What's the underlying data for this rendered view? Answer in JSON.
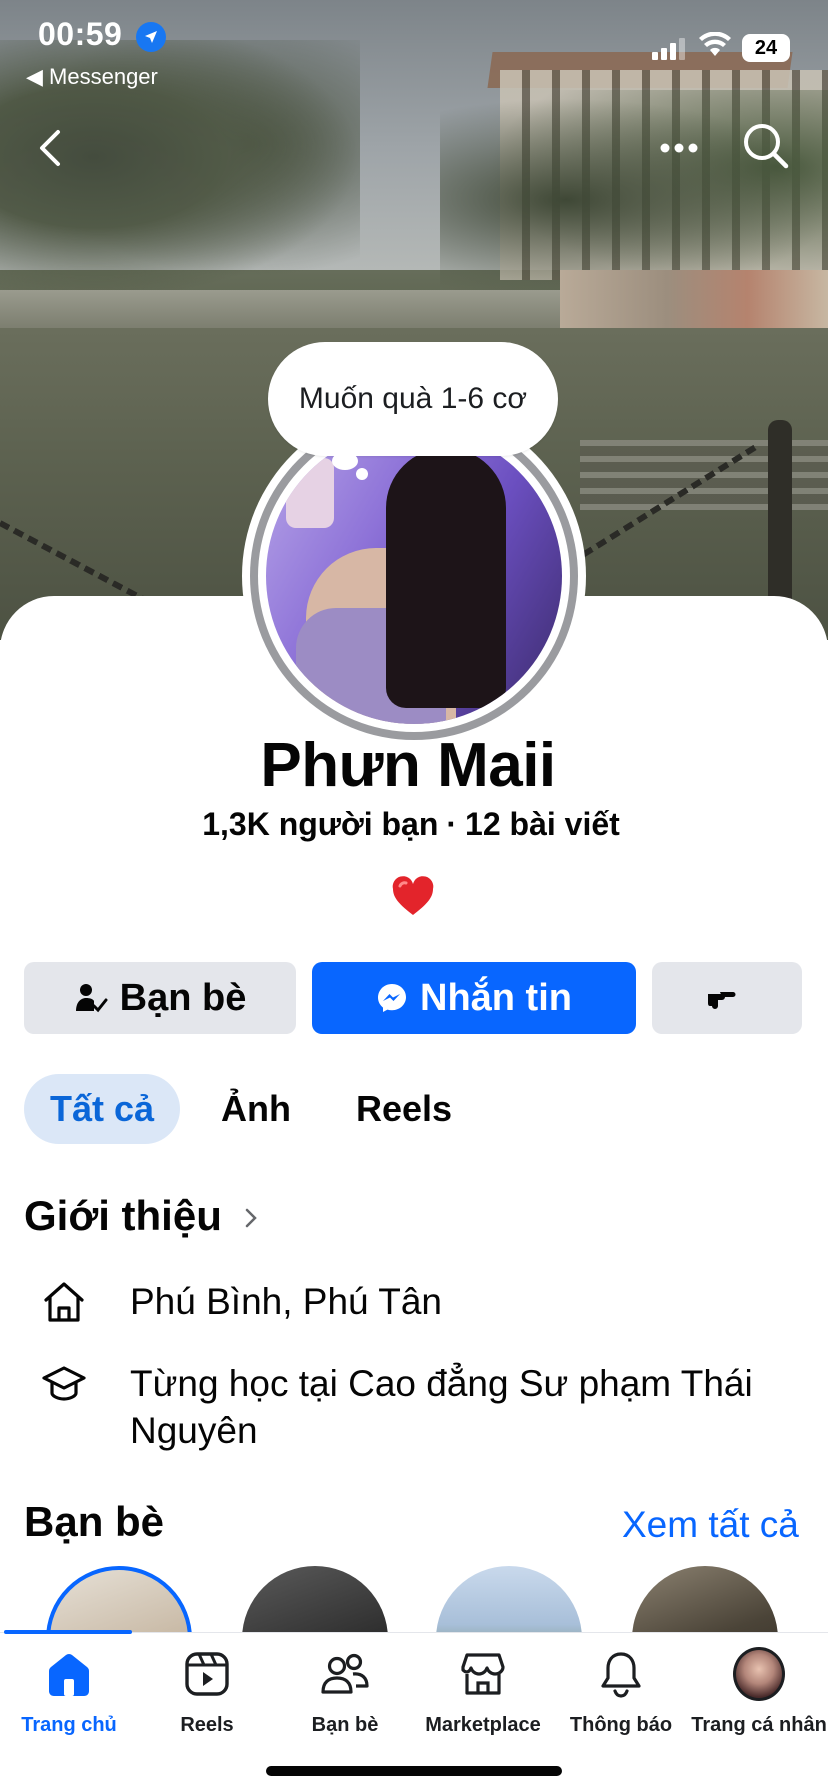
{
  "status_bar": {
    "time": "00:59",
    "back_app": "◀ Messenger",
    "battery": "24"
  },
  "profile": {
    "note": "Muốn quà 1-6 cơ",
    "name": "Phưn Maii",
    "friends_count": "1,3K người bạn",
    "separator": "·",
    "posts_count": "12 bài viết",
    "bio_emoji": "heart"
  },
  "actions": {
    "friends_label": "Bạn bè",
    "message_label": "Nhắn tin",
    "more_icon": "pointing-hand-icon"
  },
  "tabs": [
    {
      "label": "Tất cả",
      "active": true
    },
    {
      "label": "Ảnh",
      "active": false
    },
    {
      "label": "Reels",
      "active": false
    }
  ],
  "intro": {
    "title": "Giới thiệu",
    "items": [
      {
        "icon": "home-icon",
        "text": "Phú Bình, Phú Tân"
      },
      {
        "icon": "graduation-cap-icon",
        "text": "Từng học tại Cao đẳng Sư phạm Thái Nguyên"
      }
    ]
  },
  "friends": {
    "title": "Bạn bè",
    "see_all": "Xem tất cả"
  },
  "bottom_nav": [
    {
      "label": "Trang chủ",
      "icon": "home-icon",
      "active": true
    },
    {
      "label": "Reels",
      "icon": "reels-icon",
      "active": false
    },
    {
      "label": "Bạn bè",
      "icon": "friends-icon",
      "active": false
    },
    {
      "label": "Marketplace",
      "icon": "marketplace-icon",
      "active": false
    },
    {
      "label": "Thông báo",
      "icon": "bell-icon",
      "active": false
    },
    {
      "label": "Trang cá nhân",
      "icon": "profile-avatar",
      "active": false
    }
  ],
  "colors": {
    "accent": "#0866ff",
    "secondary_button": "#e4e6eb",
    "active_tab_bg": "#dbe7f7",
    "heart": "#e3242b"
  }
}
